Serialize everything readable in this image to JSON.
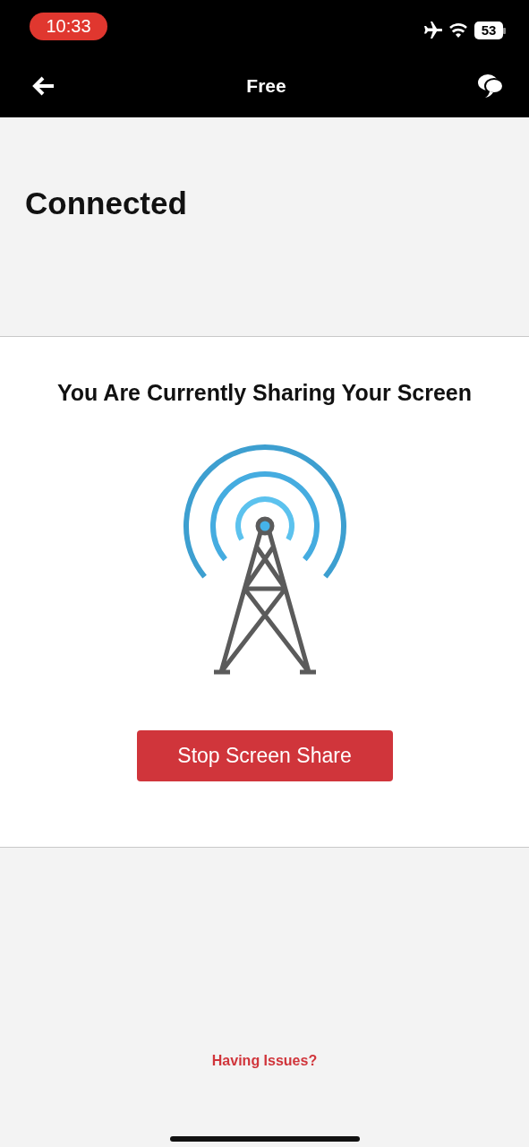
{
  "status_bar": {
    "time": "10:33",
    "battery": "53"
  },
  "nav": {
    "title": "Free"
  },
  "connection": {
    "status": "Connected"
  },
  "share": {
    "message": "You Are Currently Sharing Your Screen",
    "button": "Stop Screen Share"
  },
  "help_link": "Having Issues?"
}
